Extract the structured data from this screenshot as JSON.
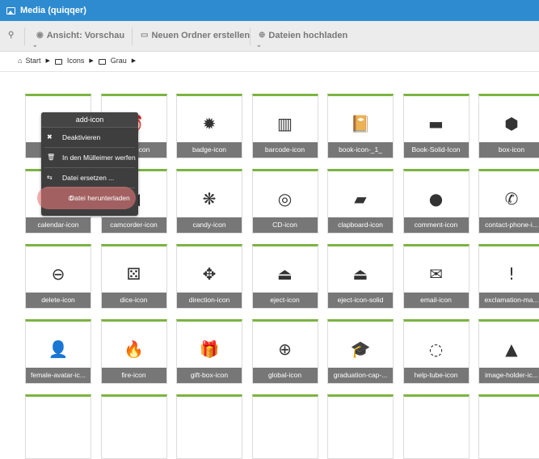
{
  "window": {
    "title": "Media (quiqqer)"
  },
  "toolbar": {
    "view_label": "Ansicht: Vorschau",
    "new_folder_label": "Neuen Ordner erstellen",
    "upload_label": "Dateien hochladen"
  },
  "breadcrumb": {
    "items": [
      "Start",
      "Icons",
      "Grau"
    ]
  },
  "context_menu": {
    "title": "add-icon",
    "items": [
      "Deaktivieren",
      "In den Mülleimer werfen",
      "Datei ersetzen ...",
      "Datei herunterladen"
    ]
  },
  "tiles": [
    {
      "label": "add-icon",
      "icon": "plus-icon",
      "glyph": "+"
    },
    {
      "label": "alarm-icon",
      "icon": "alarm-icon",
      "glyph": "⏰"
    },
    {
      "label": "badge-icon",
      "icon": "badge-icon",
      "glyph": "✹"
    },
    {
      "label": "barcode-icon",
      "icon": "barcode-icon",
      "glyph": "▥"
    },
    {
      "label": "book-icon-_1_",
      "icon": "book-icon",
      "glyph": "📔"
    },
    {
      "label": "Book-Solid-Icon",
      "icon": "book-solid-icon",
      "glyph": "▬"
    },
    {
      "label": "box-icon",
      "icon": "box-icon",
      "glyph": "⬢"
    },
    {
      "label": "calendar-icon",
      "icon": "calendar-icon",
      "glyph": "▦"
    },
    {
      "label": "camcorder-icon",
      "icon": "camcorder-icon",
      "glyph": "◀"
    },
    {
      "label": "candy-icon",
      "icon": "candy-icon",
      "glyph": "❋"
    },
    {
      "label": "CD-icon",
      "icon": "cd-icon",
      "glyph": "◎"
    },
    {
      "label": "clapboard-icon",
      "icon": "clapboard-icon",
      "glyph": "▰"
    },
    {
      "label": "comment-icon",
      "icon": "comment-icon",
      "glyph": "●"
    },
    {
      "label": "contact-phone-i...",
      "icon": "phone-icon",
      "glyph": "✆"
    },
    {
      "label": "delete-icon",
      "icon": "delete-icon",
      "glyph": "⊖"
    },
    {
      "label": "dice-icon",
      "icon": "dice-icon",
      "glyph": "⚄"
    },
    {
      "label": "direction-icon",
      "icon": "direction-icon",
      "glyph": "✥"
    },
    {
      "label": "eject-icon",
      "icon": "eject-icon",
      "glyph": "⏏"
    },
    {
      "label": "eject-icon-solid",
      "icon": "eject-solid-icon",
      "glyph": "⏏"
    },
    {
      "label": "email-icon",
      "icon": "email-icon",
      "glyph": "✉"
    },
    {
      "label": "exclamation-ma...",
      "icon": "exclamation-icon",
      "glyph": "!"
    },
    {
      "label": "female-avatar-ic...",
      "icon": "female-avatar-icon",
      "glyph": "👤"
    },
    {
      "label": "fire-icon",
      "icon": "fire-icon",
      "glyph": "🔥"
    },
    {
      "label": "gift-box-icon",
      "icon": "gift-box-icon",
      "glyph": "🎁"
    },
    {
      "label": "global-icon",
      "icon": "globe-icon",
      "glyph": "⊕"
    },
    {
      "label": "graduation-cap-...",
      "icon": "graduation-cap-icon",
      "glyph": "🎓"
    },
    {
      "label": "help-tube-icon",
      "icon": "lifebuoy-icon",
      "glyph": "◌"
    },
    {
      "label": "image-holder-ic...",
      "icon": "image-icon",
      "glyph": "▲"
    }
  ]
}
